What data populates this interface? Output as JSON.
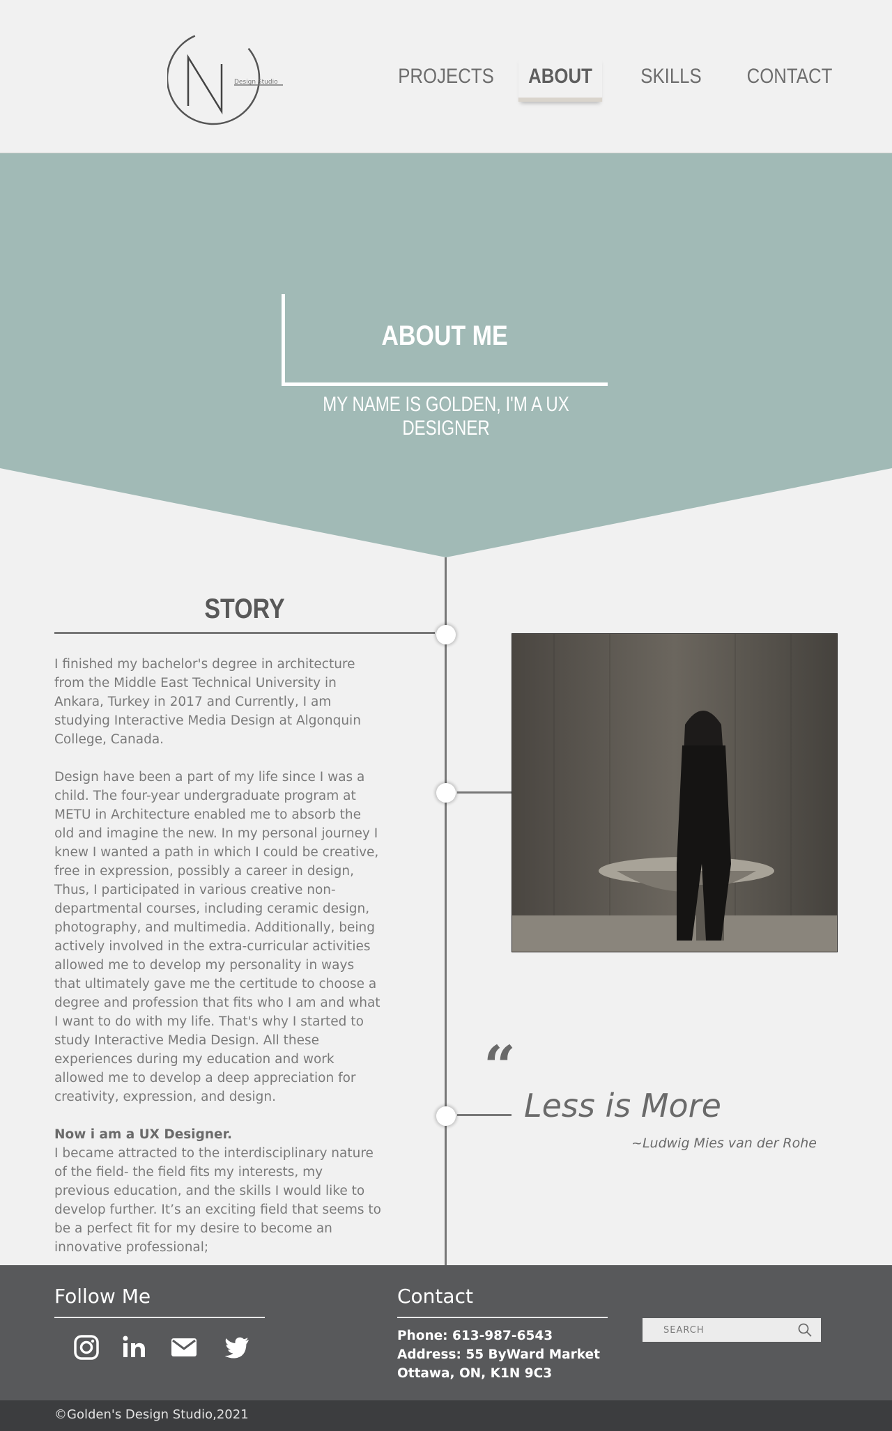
{
  "header": {
    "logo_text": "Design Studio",
    "nav": [
      {
        "label": "PROJECTS",
        "active": false
      },
      {
        "label": "ABOUT",
        "active": true
      },
      {
        "label": "SKILLS",
        "active": false
      },
      {
        "label": "CONTACT",
        "active": false
      }
    ]
  },
  "hero": {
    "title": "ABOUT ME",
    "subtitle": "MY NAME IS GOLDEN, I'M A UX DESIGNER",
    "color": "#a1bab6"
  },
  "story": {
    "heading": "STORY",
    "paragraph1": "I finished my bachelor's degree in architecture from the Middle East Technical University in Ankara, Turkey in 2017 and Currently, I am studying Interactive Media Design at Algonquin College, Canada.",
    "paragraph2": "Design have been a part of my life since I was a child. The four-year undergraduate program at METU in Architecture enabled me to absorb the old and imagine the new. In my personal journey I knew I wanted a path in which I could be creative, free in expression, possibly a career in design, Thus, I participated in various creative non-departmental courses, including ceramic design, photography, and multimedia. Additionally, being actively involved in the extra-curricular activities allowed me to develop my personality in ways that ultimately gave me the certitude to choose a degree and profession that fits who I am and what I want to do with my life. That's why I started to study Interactive Media Design. All these experiences during my education and work allowed me to develop a deep appreciation for creativity, expression, and design.",
    "subheading": "Now i am a UX Designer.",
    "paragraph3": "I became attracted to the interdisciplinary nature of the field- the field fits my interests, my previous education, and the skills I would like to develop further. It’s an exciting field that seems to be a perfect fit for my desire to become an innovative professional;"
  },
  "quote": {
    "mark": "“",
    "text": "Less is More",
    "author": "~Ludwig Mies van der Rohe"
  },
  "footer": {
    "follow_heading": "Follow Me",
    "social_icons": [
      "instagram-icon",
      "linkedin-icon",
      "mail-icon",
      "twitter-icon"
    ],
    "contact_heading": "Contact",
    "phone": "Phone: 613-987-6543",
    "address1": "Address: 55 ByWard Market",
    "address2": "Ottawa, ON, K1N 9C3",
    "search_placeholder": "SEARCH",
    "copyright": "©Golden's Design Studio,2021",
    "color": "#58595b"
  }
}
